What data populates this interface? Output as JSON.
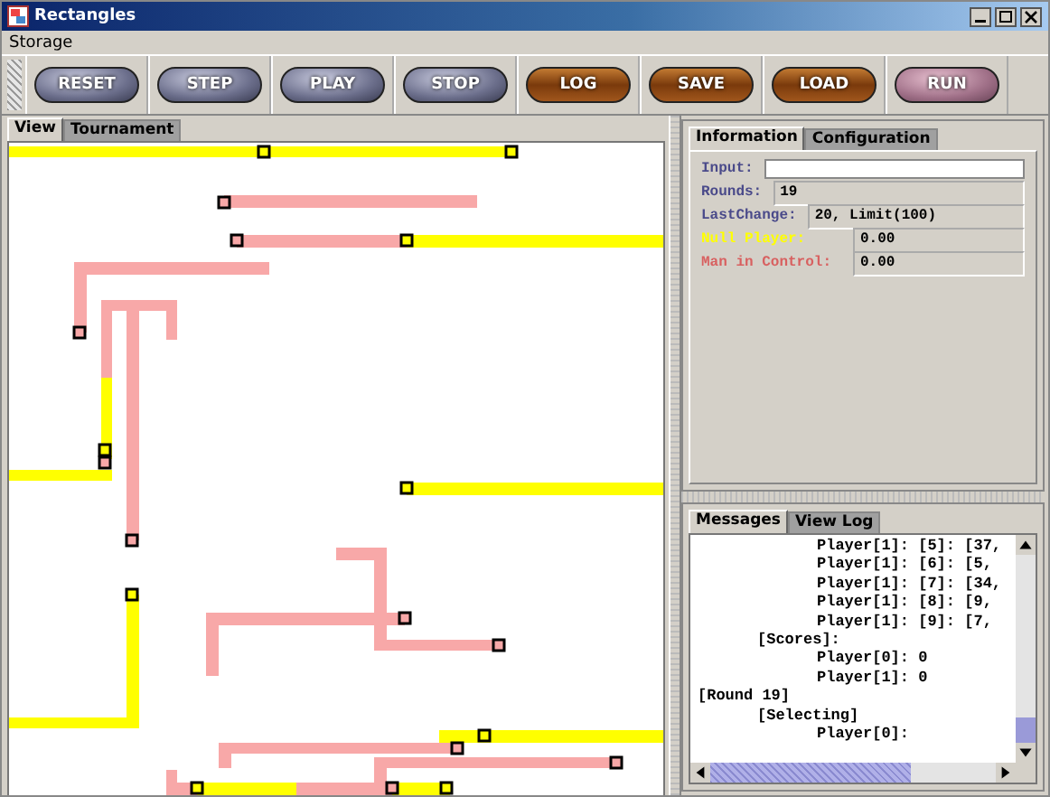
{
  "window": {
    "title": "Rectangles"
  },
  "menu": [
    {
      "label": "Storage"
    }
  ],
  "toolbar": [
    {
      "label": "RESET",
      "kind": "steel"
    },
    {
      "label": "STEP",
      "kind": "steel"
    },
    {
      "label": "PLAY",
      "kind": "steel"
    },
    {
      "label": "STOP",
      "kind": "steel"
    },
    {
      "label": "LOG",
      "kind": "wood"
    },
    {
      "label": "SAVE",
      "kind": "wood"
    },
    {
      "label": "LOAD",
      "kind": "wood"
    },
    {
      "label": "RUN",
      "kind": "rose"
    }
  ],
  "view_tabs": [
    {
      "label": "View",
      "selected": true
    },
    {
      "label": "Tournament",
      "selected": false
    }
  ],
  "info_tabs": [
    {
      "label": "Information",
      "selected": true
    },
    {
      "label": "Configuration",
      "selected": false
    }
  ],
  "info_fields": [
    {
      "label": "Input:",
      "kind": "input",
      "color": "#4a4a8a"
    },
    {
      "label": "Rounds:",
      "value": "19",
      "kind": "wide",
      "color": "#4a4a8a"
    },
    {
      "label": "LastChange:",
      "value": "20, Limit(100)",
      "kind": "wide",
      "color": "#4a4a8a"
    },
    {
      "label": "Null Player:",
      "value": "0.00",
      "kind": "narrow",
      "color": "#ffff00"
    },
    {
      "label": "Man in Control:",
      "value": "0.00",
      "kind": "narrow",
      "color": "#d86060"
    }
  ],
  "message_tabs": [
    {
      "label": "Messages",
      "selected": true
    },
    {
      "label": "View Log",
      "selected": false
    }
  ],
  "log": [
    {
      "children": [
        {
          "children": [
            {
              "text": "Player[1]: [5]: [37,"
            },
            {
              "text": "Player[1]: [6]: [5,"
            },
            {
              "text": "Player[1]: [7]: [34,"
            },
            {
              "text": "Player[1]: [8]: [9,"
            },
            {
              "text": "Player[1]: [9]: [7,"
            }
          ]
        },
        {
          "text": "[Scores]:",
          "children": [
            {
              "text": "Player[0]: 0"
            },
            {
              "text": "Player[1]: 0"
            }
          ]
        }
      ]
    },
    {
      "text": "[Round 19]",
      "children": [
        {
          "text": "[Selecting]",
          "children": [
            {
              "text": "Player[0]:"
            }
          ]
        }
      ]
    }
  ]
}
